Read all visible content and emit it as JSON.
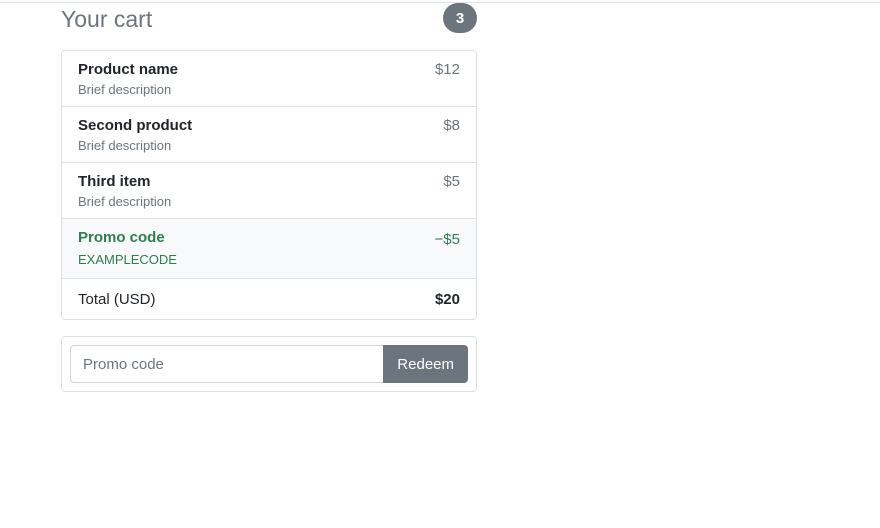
{
  "cart": {
    "title": "Your cart",
    "count": "3",
    "items": [
      {
        "name": "Product name",
        "description": "Brief description",
        "price": "$12"
      },
      {
        "name": "Second product",
        "description": "Brief description",
        "price": "$8"
      },
      {
        "name": "Third item",
        "description": "Brief description",
        "price": "$5"
      }
    ],
    "promo": {
      "name": "Promo code",
      "code": "EXAMPLECODE",
      "amount": "−$5"
    },
    "total": {
      "label": "Total (USD)",
      "value": "$20"
    }
  },
  "redeem": {
    "placeholder": "Promo code",
    "value": "",
    "button_label": "Redeem"
  },
  "colors": {
    "muted": "#6c757d",
    "success": "#2e7d4f",
    "border": "#dee2e6"
  }
}
